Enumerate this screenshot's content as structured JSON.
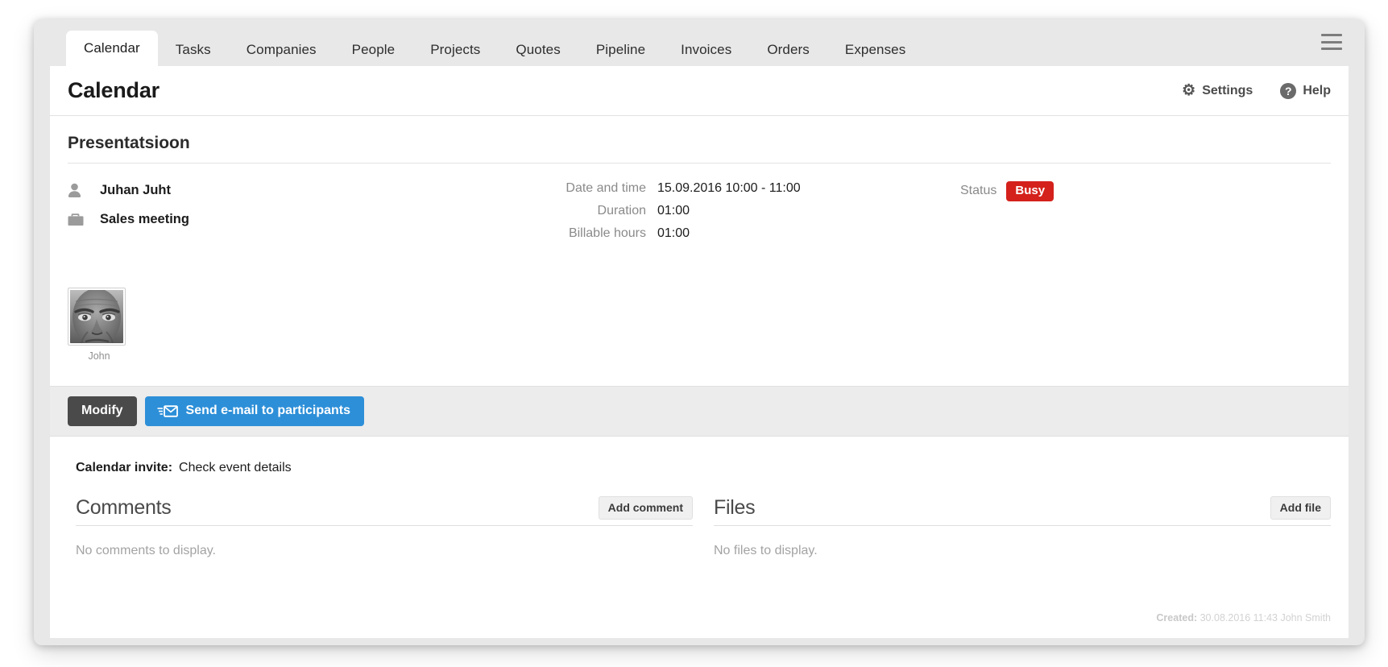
{
  "window": {
    "tabs": [
      {
        "label": "Calendar",
        "active": true
      },
      {
        "label": "Tasks",
        "active": false
      },
      {
        "label": "Companies",
        "active": false
      },
      {
        "label": "People",
        "active": false
      },
      {
        "label": "Projects",
        "active": false
      },
      {
        "label": "Quotes",
        "active": false
      },
      {
        "label": "Pipeline",
        "active": false
      },
      {
        "label": "Invoices",
        "active": false
      },
      {
        "label": "Orders",
        "active": false
      },
      {
        "label": "Expenses",
        "active": false
      }
    ],
    "menu_icon": "hamburger-menu-icon"
  },
  "header": {
    "title": "Calendar",
    "settings_label": "Settings",
    "settings_icon": "gear-icon",
    "help_label": "Help",
    "help_icon": "question-circle-icon"
  },
  "event": {
    "title": "Presentatsioon",
    "person_icon": "person-icon",
    "person_name": "Juhan Juht",
    "category_icon": "briefcase-icon",
    "category_name": "Sales meeting",
    "fields": [
      {
        "label": "Date and time",
        "value": "15.09.2016 10:00 - 11:00"
      },
      {
        "label": "Duration",
        "value": "01:00"
      },
      {
        "label": "Billable hours",
        "value": "01:00"
      }
    ],
    "status_label": "Status",
    "status_value": "Busy",
    "status_color": "#d4211b",
    "participants": [
      {
        "name": "John",
        "avatar": "grayscale-face-photo"
      }
    ]
  },
  "actions": {
    "modify_label": "Modify",
    "send_email_label": "Send e-mail to participants",
    "send_email_icon": "envelope-icon",
    "modify_color": "#4a4a4a",
    "send_email_color": "#2d8fd8"
  },
  "invite": {
    "label": "Calendar invite:",
    "value": "Check event details"
  },
  "comments": {
    "title": "Comments",
    "button_label": "Add comment",
    "empty_text": "No comments to display."
  },
  "files": {
    "title": "Files",
    "button_label": "Add file",
    "empty_text": "No files to display."
  },
  "footer": {
    "created_label": "Created:",
    "created_value": "30.08.2016 11:43 John Smith"
  }
}
